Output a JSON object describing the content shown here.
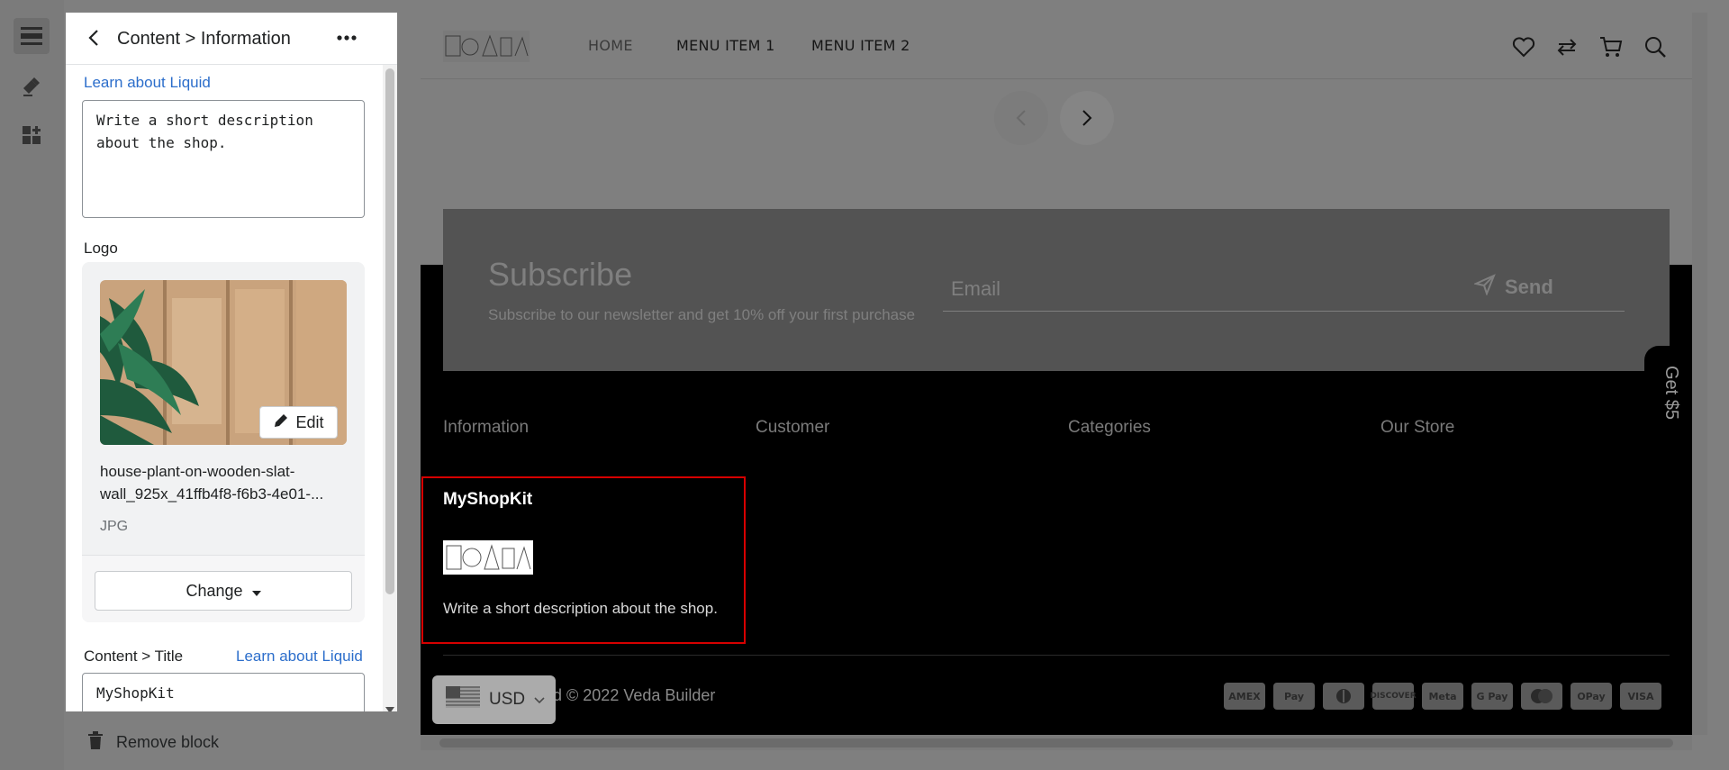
{
  "sidebar": {
    "icons": [
      "sections-icon",
      "theme-settings-icon",
      "app-blocks-icon"
    ]
  },
  "panel": {
    "title": "Content > Information",
    "learn_link_top": "Learn about Liquid",
    "description_value": "Write a short description about the shop.",
    "logo_label": "Logo",
    "edit_label": "Edit",
    "file_name": "house-plant-on-wooden-slat-wall_925x_41ffb4f8-f6b3-4e01-...",
    "file_type": "JPG",
    "change_label": "Change",
    "title_field_label": "Content > Title",
    "learn_link_title": "Learn about Liquid",
    "title_value": "MyShopKit",
    "remove_block_label": "Remove block"
  },
  "preview": {
    "nav": [
      "HOME",
      "MENU ITEM 1",
      "MENU ITEM 2"
    ],
    "subscribe": {
      "title": "Subscribe",
      "description": "Subscribe to our newsletter and get 10% off your first purchase",
      "email_placeholder": "Email",
      "send_label": "Send"
    },
    "get_reward": "Get $5",
    "footer_columns": [
      "Information",
      "Customer",
      "Categories",
      "Our Store"
    ],
    "shop_name": "MyShopKit",
    "shop_description": "Write a short description about the shop.",
    "copyright": "ed © 2022 Veda Builder",
    "currency": "USD",
    "payments": [
      "AMEX",
      "Pay",
      "Diners",
      "DISCOVER",
      "Meta",
      "G Pay",
      "Master",
      "OPay",
      "VISA"
    ]
  },
  "colors": {
    "link": "#2c6ecb",
    "highlight": "#d60000"
  }
}
